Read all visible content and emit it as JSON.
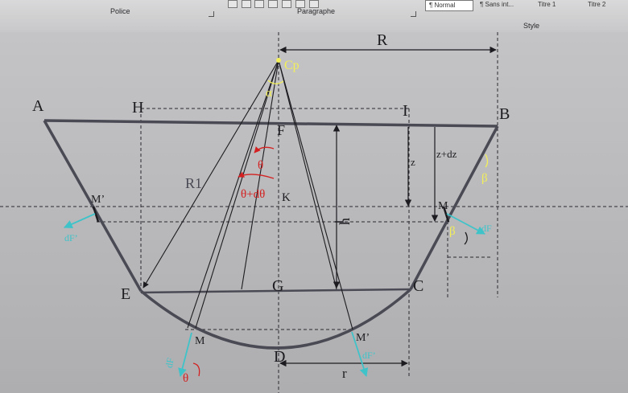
{
  "ribbon": {
    "groups": [
      {
        "label": "Police"
      },
      {
        "label": "Paragraphe"
      },
      {
        "label": "Style"
      }
    ],
    "styles": [
      "¶ Normal",
      "¶ Sans int...",
      "Titre 1",
      "Titre 2"
    ]
  },
  "diagram": {
    "points": {
      "A": "A",
      "B": "B",
      "H": "H",
      "I": "I",
      "F": "F",
      "K": "K",
      "E": "E",
      "G": "G",
      "C": "C",
      "D": "D",
      "Cp": "Cp",
      "M_right": "M",
      "M_prime_left": "M’",
      "M_bottom": "M",
      "M_prime_bottom": "M’"
    },
    "dims": {
      "R": "R",
      "R1": "R1",
      "r": "r",
      "h": "h",
      "z": "z",
      "zdz": "z+dz"
    },
    "angles": {
      "alpha": "α",
      "beta": "β",
      "beta2": "β",
      "theta": "θ",
      "theta_dtheta": "θ+dθ",
      "theta_small": "θ"
    },
    "forces": {
      "dF_left": "dF’",
      "dF_right": "dF",
      "dF_bottom": "dF",
      "dF_bottom_prime": "dF’"
    }
  },
  "colors": {
    "angle_red": "#d42020",
    "force_cyan": "#3fc3c9",
    "label_yellow": "#f2ef58",
    "ink": "#1c1c20",
    "vessel": "#4a4a55"
  }
}
